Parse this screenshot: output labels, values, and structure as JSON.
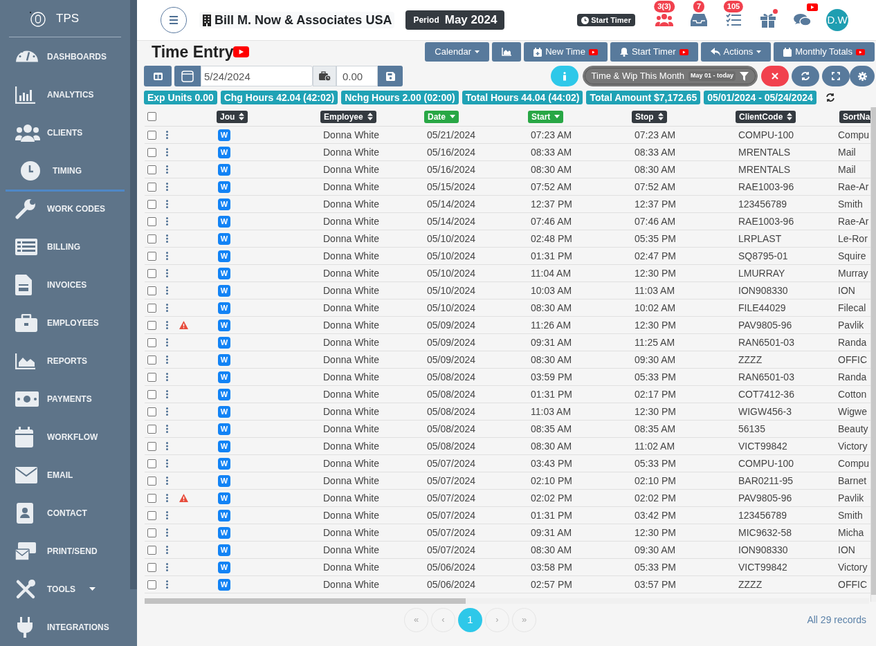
{
  "sidebar": {
    "brand": "TPS",
    "items": [
      {
        "label": "DASHBOARDS",
        "selected": false,
        "has_submenu": false
      },
      {
        "label": "ANALYTICS",
        "selected": false,
        "has_submenu": false
      },
      {
        "label": "CLIENTS",
        "selected": false,
        "has_submenu": false
      },
      {
        "label": "TIMING",
        "selected": true,
        "has_submenu": false
      },
      {
        "label": "WORK CODES",
        "selected": false,
        "has_submenu": false
      },
      {
        "label": "BILLING",
        "selected": false,
        "has_submenu": false
      },
      {
        "label": "INVOICES",
        "selected": false,
        "has_submenu": false
      },
      {
        "label": "EMPLOYEES",
        "selected": false,
        "has_submenu": false
      },
      {
        "label": "REPORTS",
        "selected": false,
        "has_submenu": false
      },
      {
        "label": "PAYMENTS",
        "selected": false,
        "has_submenu": false
      },
      {
        "label": "WORKFLOW",
        "selected": false,
        "has_submenu": false
      },
      {
        "label": "EMAIL",
        "selected": false,
        "has_submenu": false
      },
      {
        "label": "CONTACT",
        "selected": false,
        "has_submenu": false
      },
      {
        "label": "PRINT/SEND",
        "selected": false,
        "has_submenu": false
      },
      {
        "label": "TOOLS",
        "selected": false,
        "has_submenu": true
      },
      {
        "label": "INTEGRATIONS",
        "selected": false,
        "has_submenu": false
      }
    ]
  },
  "header": {
    "company": "Bill M. Now & Associates USA",
    "period_label": "Period",
    "period_value": "May 2024",
    "timer_button": "Start Timer",
    "icons": [
      {
        "badge": "3(3)",
        "alert": true
      },
      {
        "badge": "7"
      },
      {
        "badge": "105"
      },
      {
        "dot": true
      },
      {
        "video": true
      }
    ],
    "avatar": "D.W"
  },
  "page": {
    "title": "Time Entry",
    "title_video": true,
    "toolbar": [
      {
        "label": "Calendar",
        "dropdown": true,
        "video": false
      },
      {
        "dropdown": false,
        "video": false
      },
      {
        "label": "New Time",
        "dropdown": false,
        "video": true
      },
      {
        "label": "Start Timer",
        "dropdown": false,
        "video": true
      },
      {
        "label": "Actions",
        "dropdown": true,
        "video": false
      },
      {
        "label": "Monthly Totals",
        "dropdown": false,
        "video": true
      }
    ],
    "date_value": "5/24/2024",
    "hours_value": "0.00",
    "filter": {
      "label": "Time & Wip This Month",
      "range": "May 01 - today"
    },
    "summary": [
      "Exp Units 0.00",
      "Chg Hours 42.04 (42:02)",
      "Nchg Hours 2.00 (02:00)",
      "Total Hours 44.04 (44:02)",
      "Total Amount $7,172.65",
      "05/01/2024 - 05/24/2024"
    ]
  },
  "table": {
    "all_checked": false,
    "columns": [
      {
        "label": "Jou",
        "sorted": false
      },
      {
        "label": "Employee",
        "sorted": false
      },
      {
        "label": "Date",
        "sorted": true
      },
      {
        "label": "Start",
        "sorted": true
      },
      {
        "label": "Stop",
        "sorted": false
      },
      {
        "label": "ClientCode",
        "sorted": false
      },
      {
        "label": "SortNa",
        "sorted": false
      }
    ],
    "rows": [
      {
        "checked": false,
        "warning": false,
        "journal": "W",
        "employee": "Donna White",
        "date": "05/21/2024",
        "start": "07:23 AM",
        "stop": "07:23 AM",
        "client_code": "COMPU-100",
        "sort_name": "Compu"
      },
      {
        "checked": false,
        "warning": false,
        "journal": "W",
        "employee": "Donna White",
        "date": "05/16/2024",
        "start": "08:33 AM",
        "stop": "08:33 AM",
        "client_code": "MRENTALS",
        "sort_name": "Mail"
      },
      {
        "checked": false,
        "warning": false,
        "journal": "W",
        "employee": "Donna White",
        "date": "05/16/2024",
        "start": "08:30 AM",
        "stop": "08:30 AM",
        "client_code": "MRENTALS",
        "sort_name": "Mail"
      },
      {
        "checked": false,
        "warning": false,
        "journal": "W",
        "employee": "Donna White",
        "date": "05/15/2024",
        "start": "07:52 AM",
        "stop": "07:52 AM",
        "client_code": "RAE1003-96",
        "sort_name": "Rae-Ar"
      },
      {
        "checked": false,
        "warning": false,
        "journal": "W",
        "employee": "Donna White",
        "date": "05/14/2024",
        "start": "12:37 PM",
        "stop": "12:37 PM",
        "client_code": "123456789",
        "sort_name": "Smith"
      },
      {
        "checked": false,
        "warning": false,
        "journal": "W",
        "employee": "Donna White",
        "date": "05/14/2024",
        "start": "07:46 AM",
        "stop": "07:46 AM",
        "client_code": "RAE1003-96",
        "sort_name": "Rae-Ar"
      },
      {
        "checked": false,
        "warning": false,
        "journal": "W",
        "employee": "Donna White",
        "date": "05/10/2024",
        "start": "02:48 PM",
        "stop": "05:35 PM",
        "client_code": "LRPLAST",
        "sort_name": "Le-Ror"
      },
      {
        "checked": false,
        "warning": false,
        "journal": "W",
        "employee": "Donna White",
        "date": "05/10/2024",
        "start": "01:31 PM",
        "stop": "02:47 PM",
        "client_code": "SQ8795-01",
        "sort_name": "Squire"
      },
      {
        "checked": false,
        "warning": false,
        "journal": "W",
        "employee": "Donna White",
        "date": "05/10/2024",
        "start": "11:04 AM",
        "stop": "12:30 PM",
        "client_code": "LMURRAY",
        "sort_name": "Murray"
      },
      {
        "checked": false,
        "warning": false,
        "journal": "W",
        "employee": "Donna White",
        "date": "05/10/2024",
        "start": "10:03 AM",
        "stop": "11:03 AM",
        "client_code": "ION908330",
        "sort_name": "ION"
      },
      {
        "checked": false,
        "warning": false,
        "journal": "W",
        "employee": "Donna White",
        "date": "05/10/2024",
        "start": "08:30 AM",
        "stop": "10:02 AM",
        "client_code": "FILE44029",
        "sort_name": "Filecal"
      },
      {
        "checked": false,
        "warning": true,
        "journal": "W",
        "employee": "Donna White",
        "date": "05/09/2024",
        "start": "11:26 AM",
        "stop": "12:30 PM",
        "client_code": "PAV9805-96",
        "sort_name": "Pavlik"
      },
      {
        "checked": false,
        "warning": false,
        "journal": "W",
        "employee": "Donna White",
        "date": "05/09/2024",
        "start": "09:31 AM",
        "stop": "11:25 AM",
        "client_code": "RAN6501-03",
        "sort_name": "Randa"
      },
      {
        "checked": false,
        "warning": false,
        "journal": "W",
        "employee": "Donna White",
        "date": "05/09/2024",
        "start": "08:30 AM",
        "stop": "09:30 AM",
        "client_code": "ZZZZ",
        "sort_name": "OFFIC"
      },
      {
        "checked": false,
        "warning": false,
        "journal": "W",
        "employee": "Donna White",
        "date": "05/08/2024",
        "start": "03:59 PM",
        "stop": "05:33 PM",
        "client_code": "RAN6501-03",
        "sort_name": "Randa"
      },
      {
        "checked": false,
        "warning": false,
        "journal": "W",
        "employee": "Donna White",
        "date": "05/08/2024",
        "start": "01:31 PM",
        "stop": "02:17 PM",
        "client_code": "COT7412-36",
        "sort_name": "Cotton"
      },
      {
        "checked": false,
        "warning": false,
        "journal": "W",
        "employee": "Donna White",
        "date": "05/08/2024",
        "start": "11:03 AM",
        "stop": "12:30 PM",
        "client_code": "WIGW456-3",
        "sort_name": "Wigwe"
      },
      {
        "checked": false,
        "warning": false,
        "journal": "W",
        "employee": "Donna White",
        "date": "05/08/2024",
        "start": "08:35 AM",
        "stop": "08:35 AM",
        "client_code": "56135",
        "sort_name": "Beauty"
      },
      {
        "checked": false,
        "warning": false,
        "journal": "W",
        "employee": "Donna White",
        "date": "05/08/2024",
        "start": "08:30 AM",
        "stop": "11:02 AM",
        "client_code": "VICT99842",
        "sort_name": "Victory"
      },
      {
        "checked": false,
        "warning": false,
        "journal": "W",
        "employee": "Donna White",
        "date": "05/07/2024",
        "start": "03:43 PM",
        "stop": "05:33 PM",
        "client_code": "COMPU-100",
        "sort_name": "Compu"
      },
      {
        "checked": false,
        "warning": false,
        "journal": "W",
        "employee": "Donna White",
        "date": "05/07/2024",
        "start": "02:10 PM",
        "stop": "02:10 PM",
        "client_code": "BAR0211-95",
        "sort_name": "Barnet"
      },
      {
        "checked": false,
        "warning": true,
        "journal": "W",
        "employee": "Donna White",
        "date": "05/07/2024",
        "start": "02:02 PM",
        "stop": "02:02 PM",
        "client_code": "PAV9805-96",
        "sort_name": "Pavlik"
      },
      {
        "checked": false,
        "warning": false,
        "journal": "W",
        "employee": "Donna White",
        "date": "05/07/2024",
        "start": "01:31 PM",
        "stop": "03:42 PM",
        "client_code": "123456789",
        "sort_name": "Smith"
      },
      {
        "checked": false,
        "warning": false,
        "journal": "W",
        "employee": "Donna White",
        "date": "05/07/2024",
        "start": "09:31 AM",
        "stop": "12:30 PM",
        "client_code": "MIC9632-58",
        "sort_name": "Micha"
      },
      {
        "checked": false,
        "warning": false,
        "journal": "W",
        "employee": "Donna White",
        "date": "05/07/2024",
        "start": "08:30 AM",
        "stop": "09:30 AM",
        "client_code": "ION908330",
        "sort_name": "ION"
      },
      {
        "checked": false,
        "warning": false,
        "journal": "W",
        "employee": "Donna White",
        "date": "05/06/2024",
        "start": "03:58 PM",
        "stop": "05:33 PM",
        "client_code": "VICT99842",
        "sort_name": "Victory"
      },
      {
        "checked": false,
        "warning": false,
        "journal": "W",
        "employee": "Donna White",
        "date": "05/06/2024",
        "start": "02:57 PM",
        "stop": "03:57 PM",
        "client_code": "ZZZZ",
        "sort_name": "OFFIC"
      }
    ]
  },
  "pagination": {
    "pages": [
      {
        "label": "«",
        "selected": false
      },
      {
        "label": "‹",
        "selected": false
      },
      {
        "label": "1",
        "selected": true
      },
      {
        "label": "›",
        "selected": false
      },
      {
        "label": "»",
        "selected": false
      }
    ],
    "records": "All 29 records"
  }
}
